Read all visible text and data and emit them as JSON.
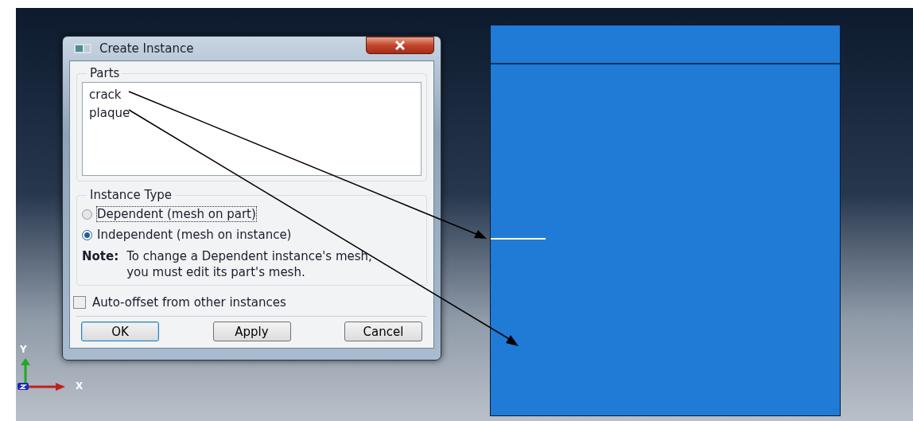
{
  "dialog": {
    "title": "Create Instance",
    "parts": {
      "label": "Parts",
      "items": [
        {
          "name": "crack",
          "selected": false
        },
        {
          "name": "plaque",
          "selected": false
        }
      ]
    },
    "instance_type": {
      "label": "Instance Type",
      "options": [
        {
          "label": "Dependent (mesh on part)",
          "selected": false,
          "focused": true
        },
        {
          "label": "Independent (mesh on instance)",
          "selected": true,
          "focused": false
        }
      ]
    },
    "note": {
      "label": "Note:",
      "text": "To change a Dependent instance's mesh, you must edit its part's mesh."
    },
    "auto_offset": {
      "label": "Auto-offset from other instances",
      "checked": false
    },
    "buttons": [
      {
        "label": "OK",
        "default": true
      },
      {
        "label": "Apply",
        "default": false
      },
      {
        "label": "Cancel",
        "default": false
      }
    ]
  },
  "axes": {
    "y": "Y",
    "x": "X"
  }
}
